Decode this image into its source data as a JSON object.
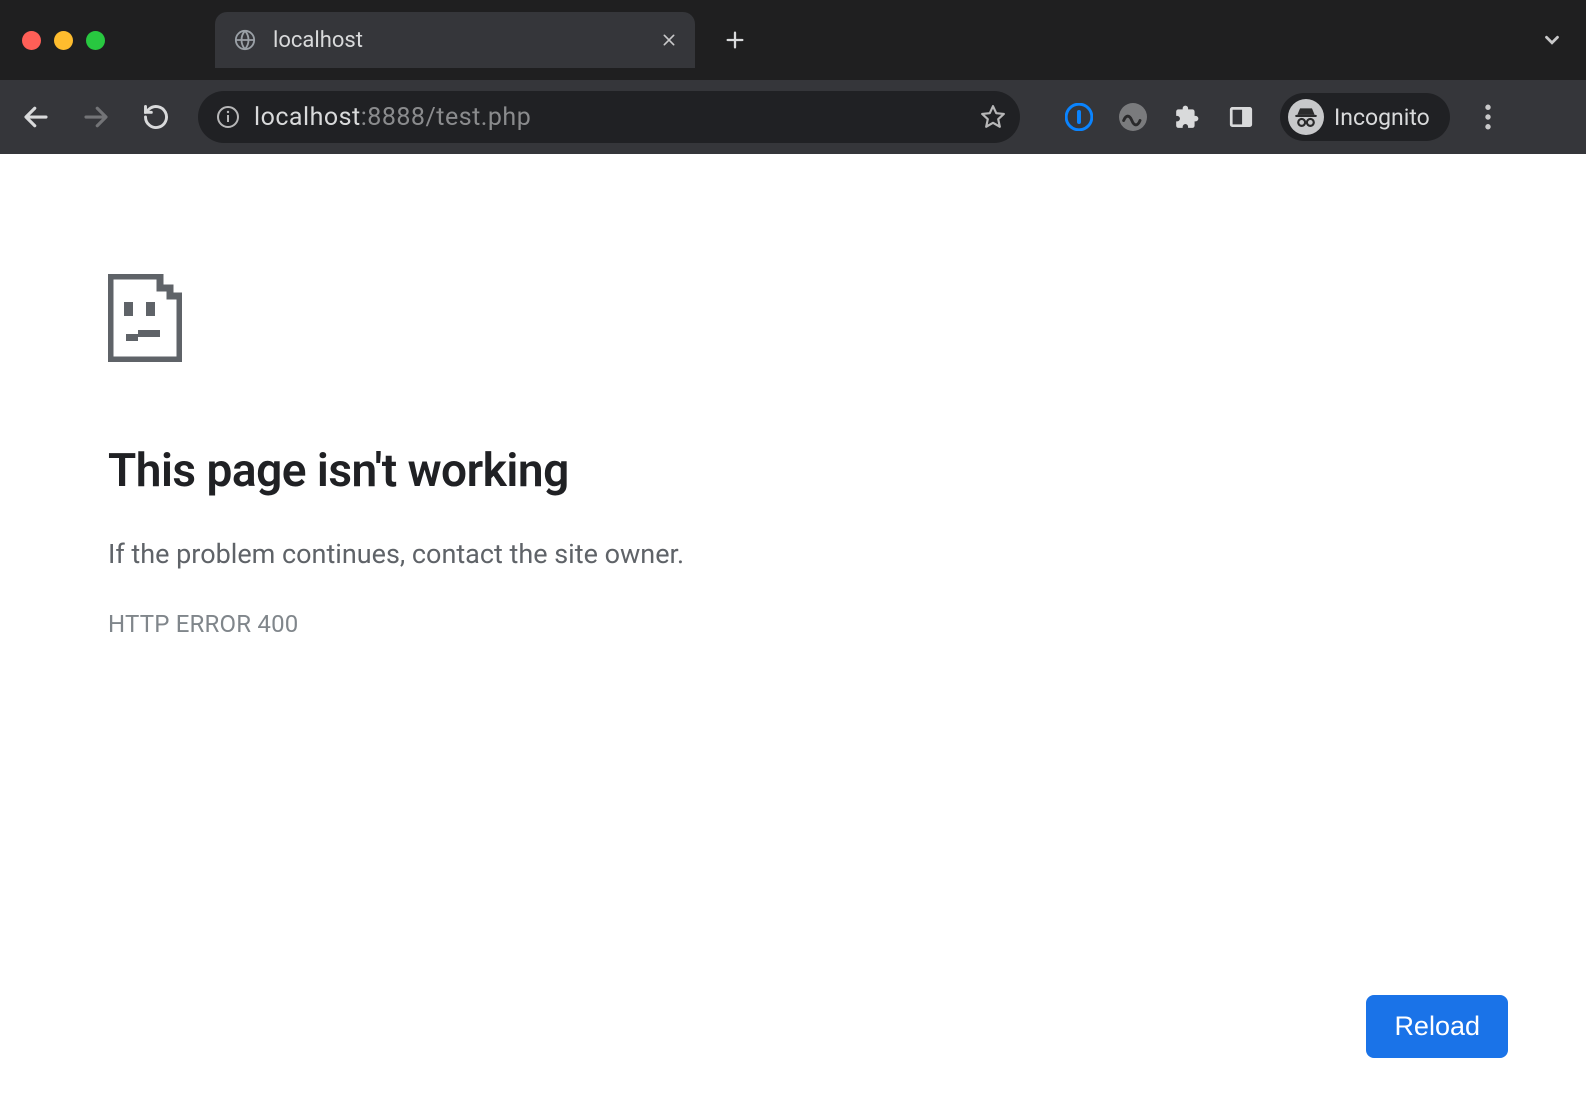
{
  "window": {
    "tab_title": "localhost",
    "incognito_label": "Incognito"
  },
  "address": {
    "host": "localhost",
    "port_path": ":8888/test.php"
  },
  "error": {
    "headline": "This page isn't working",
    "subtext": "If the problem continues, contact the site owner.",
    "code": "HTTP ERROR 400",
    "reload_label": "Reload"
  }
}
